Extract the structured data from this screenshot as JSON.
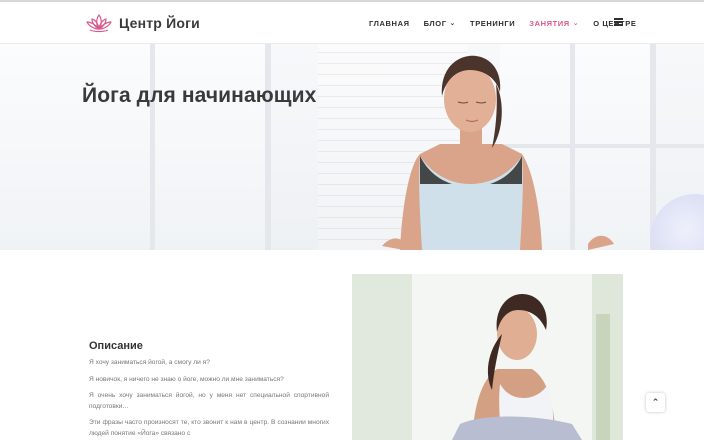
{
  "brand": {
    "logo_icon": "lotus-icon",
    "name": "Центр Йоги",
    "accent_color": "#d85a8c"
  },
  "nav": {
    "items": [
      {
        "label": "ГЛАВНАЯ",
        "has_dropdown": false,
        "active": false
      },
      {
        "label": "БЛОГ",
        "has_dropdown": true,
        "active": false
      },
      {
        "label": "ТРЕНИНГИ",
        "has_dropdown": false,
        "active": false
      },
      {
        "label": "ЗАНЯТИЯ",
        "has_dropdown": true,
        "active": true
      },
      {
        "label": "О ЦЕНТРЕ",
        "has_dropdown": false,
        "active": false
      }
    ],
    "menu_icon": "hamburger-icon",
    "dropdown_icon": "chevron-down-icon",
    "dropdown_glyph": "⌄"
  },
  "hero": {
    "title": "Йога для начинающих"
  },
  "description": {
    "title": "Описание",
    "paragraphs": [
      "Я хочу заниматься йогой, а смогу ли я?",
      "Я новичок, я ничего не знаю о йоге, можно ли мне заниматься?",
      "Я очень хочу заниматься йогой, но у меня нет специальной спортивной подготовки…",
      "Эти фразы часто произносят те, кто звонит к нам в центр. В сознании многих людей понятие «Йога» связано с"
    ]
  },
  "scroll_top": {
    "icon": "chevron-up-icon",
    "glyph": "⌃"
  }
}
